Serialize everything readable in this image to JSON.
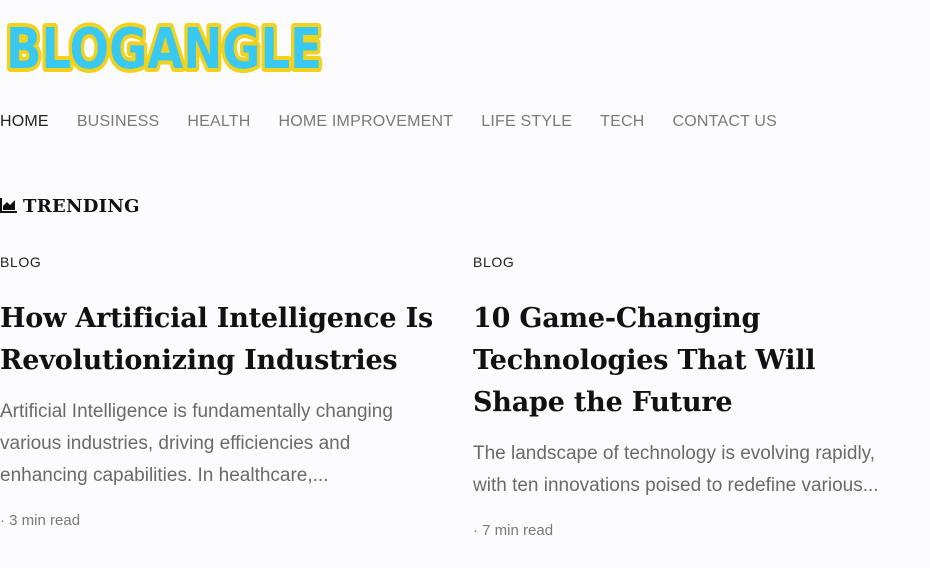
{
  "logo": {
    "text": "BLOGANGLE"
  },
  "nav": {
    "items": [
      {
        "label": "HOME",
        "active": true
      },
      {
        "label": "BUSINESS"
      },
      {
        "label": "HEALTH"
      },
      {
        "label": "HOME IMPROVEMENT"
      },
      {
        "label": "LIFE STYLE"
      },
      {
        "label": "TECH"
      },
      {
        "label": "CONTACT US"
      }
    ]
  },
  "trending": {
    "icon": "area-chart-icon",
    "label": "TRENDING"
  },
  "posts": [
    {
      "category": "BLOG",
      "title": "How Artificial Intelligence Is Revolutionizing Industries",
      "excerpt": "Artificial Intelligence is fundamentally changing various industries, driving efficiencies and enhancing capabilities. In healthcare,...",
      "read_time": "· 3 min read"
    },
    {
      "category": "BLOG",
      "title": "10 Game-Changing Technologies That Will Shape the Future",
      "excerpt": "The landscape of technology is evolving rapidly, with ten innovations poised to redefine various...",
      "read_time": "· 7 min read"
    }
  ],
  "colors": {
    "logo_fill": "#39c8f2",
    "logo_outline": "#f2d21b",
    "text_dark": "#111111",
    "text_muted": "#6a6a6a"
  }
}
